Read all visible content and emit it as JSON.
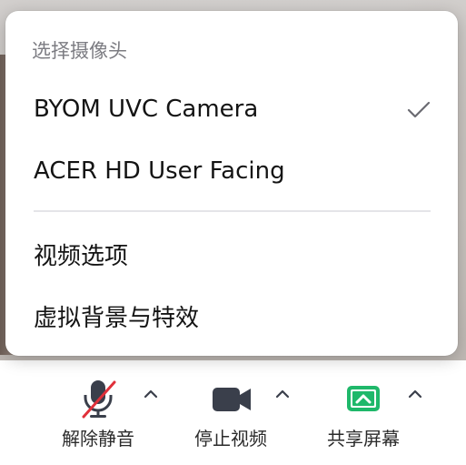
{
  "camera_menu": {
    "header": "选择摄像头",
    "cameras": [
      {
        "label": "BYOM UVC Camera",
        "selected": true
      },
      {
        "label": "ACER HD User Facing",
        "selected": false
      }
    ],
    "options": [
      {
        "label": "视频选项"
      },
      {
        "label": "虚拟背景与特效"
      }
    ],
    "check_icon": "checkmark-icon"
  },
  "toolbar": {
    "items": [
      {
        "label": "解除静音",
        "icon": "microphone-muted-icon",
        "icon_color": "#3a3f4b",
        "slash_color": "#e0303a"
      },
      {
        "label": "停止视频",
        "icon": "video-camera-icon",
        "icon_color": "#3a3f4b"
      },
      {
        "label": "共享屏幕",
        "icon": "share-screen-icon",
        "icon_color": "#1fb86a"
      }
    ],
    "caret_icon": "chevron-up-icon"
  },
  "colors": {
    "menu_background": "#ffffff",
    "header_text": "#7c7c82",
    "item_text": "#141414",
    "share_green": "#1fb86a",
    "muted_red": "#e0303a"
  }
}
